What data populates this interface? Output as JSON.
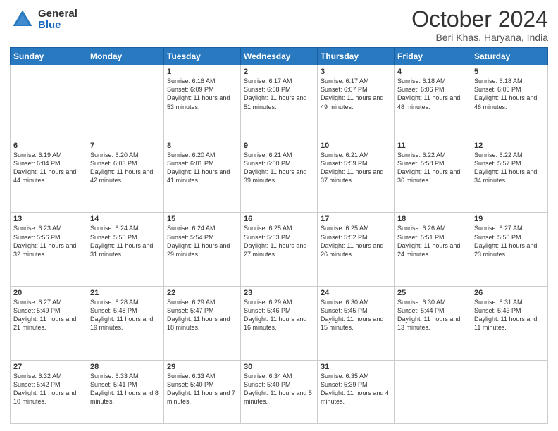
{
  "header": {
    "logo_general": "General",
    "logo_blue": "Blue",
    "month_title": "October 2024",
    "location": "Beri Khas, Haryana, India"
  },
  "weekdays": [
    "Sunday",
    "Monday",
    "Tuesday",
    "Wednesday",
    "Thursday",
    "Friday",
    "Saturday"
  ],
  "weeks": [
    [
      {
        "day": null
      },
      {
        "day": null
      },
      {
        "day": 1,
        "sunrise": "Sunrise: 6:16 AM",
        "sunset": "Sunset: 6:09 PM",
        "daylight": "Daylight: 11 hours and 53 minutes."
      },
      {
        "day": 2,
        "sunrise": "Sunrise: 6:17 AM",
        "sunset": "Sunset: 6:08 PM",
        "daylight": "Daylight: 11 hours and 51 minutes."
      },
      {
        "day": 3,
        "sunrise": "Sunrise: 6:17 AM",
        "sunset": "Sunset: 6:07 PM",
        "daylight": "Daylight: 11 hours and 49 minutes."
      },
      {
        "day": 4,
        "sunrise": "Sunrise: 6:18 AM",
        "sunset": "Sunset: 6:06 PM",
        "daylight": "Daylight: 11 hours and 48 minutes."
      },
      {
        "day": 5,
        "sunrise": "Sunrise: 6:18 AM",
        "sunset": "Sunset: 6:05 PM",
        "daylight": "Daylight: 11 hours and 46 minutes."
      }
    ],
    [
      {
        "day": 6,
        "sunrise": "Sunrise: 6:19 AM",
        "sunset": "Sunset: 6:04 PM",
        "daylight": "Daylight: 11 hours and 44 minutes."
      },
      {
        "day": 7,
        "sunrise": "Sunrise: 6:20 AM",
        "sunset": "Sunset: 6:03 PM",
        "daylight": "Daylight: 11 hours and 42 minutes."
      },
      {
        "day": 8,
        "sunrise": "Sunrise: 6:20 AM",
        "sunset": "Sunset: 6:01 PM",
        "daylight": "Daylight: 11 hours and 41 minutes."
      },
      {
        "day": 9,
        "sunrise": "Sunrise: 6:21 AM",
        "sunset": "Sunset: 6:00 PM",
        "daylight": "Daylight: 11 hours and 39 minutes."
      },
      {
        "day": 10,
        "sunrise": "Sunrise: 6:21 AM",
        "sunset": "Sunset: 5:59 PM",
        "daylight": "Daylight: 11 hours and 37 minutes."
      },
      {
        "day": 11,
        "sunrise": "Sunrise: 6:22 AM",
        "sunset": "Sunset: 5:58 PM",
        "daylight": "Daylight: 11 hours and 36 minutes."
      },
      {
        "day": 12,
        "sunrise": "Sunrise: 6:22 AM",
        "sunset": "Sunset: 5:57 PM",
        "daylight": "Daylight: 11 hours and 34 minutes."
      }
    ],
    [
      {
        "day": 13,
        "sunrise": "Sunrise: 6:23 AM",
        "sunset": "Sunset: 5:56 PM",
        "daylight": "Daylight: 11 hours and 32 minutes."
      },
      {
        "day": 14,
        "sunrise": "Sunrise: 6:24 AM",
        "sunset": "Sunset: 5:55 PM",
        "daylight": "Daylight: 11 hours and 31 minutes."
      },
      {
        "day": 15,
        "sunrise": "Sunrise: 6:24 AM",
        "sunset": "Sunset: 5:54 PM",
        "daylight": "Daylight: 11 hours and 29 minutes."
      },
      {
        "day": 16,
        "sunrise": "Sunrise: 6:25 AM",
        "sunset": "Sunset: 5:53 PM",
        "daylight": "Daylight: 11 hours and 27 minutes."
      },
      {
        "day": 17,
        "sunrise": "Sunrise: 6:25 AM",
        "sunset": "Sunset: 5:52 PM",
        "daylight": "Daylight: 11 hours and 26 minutes."
      },
      {
        "day": 18,
        "sunrise": "Sunrise: 6:26 AM",
        "sunset": "Sunset: 5:51 PM",
        "daylight": "Daylight: 11 hours and 24 minutes."
      },
      {
        "day": 19,
        "sunrise": "Sunrise: 6:27 AM",
        "sunset": "Sunset: 5:50 PM",
        "daylight": "Daylight: 11 hours and 23 minutes."
      }
    ],
    [
      {
        "day": 20,
        "sunrise": "Sunrise: 6:27 AM",
        "sunset": "Sunset: 5:49 PM",
        "daylight": "Daylight: 11 hours and 21 minutes."
      },
      {
        "day": 21,
        "sunrise": "Sunrise: 6:28 AM",
        "sunset": "Sunset: 5:48 PM",
        "daylight": "Daylight: 11 hours and 19 minutes."
      },
      {
        "day": 22,
        "sunrise": "Sunrise: 6:29 AM",
        "sunset": "Sunset: 5:47 PM",
        "daylight": "Daylight: 11 hours and 18 minutes."
      },
      {
        "day": 23,
        "sunrise": "Sunrise: 6:29 AM",
        "sunset": "Sunset: 5:46 PM",
        "daylight": "Daylight: 11 hours and 16 minutes."
      },
      {
        "day": 24,
        "sunrise": "Sunrise: 6:30 AM",
        "sunset": "Sunset: 5:45 PM",
        "daylight": "Daylight: 11 hours and 15 minutes."
      },
      {
        "day": 25,
        "sunrise": "Sunrise: 6:30 AM",
        "sunset": "Sunset: 5:44 PM",
        "daylight": "Daylight: 11 hours and 13 minutes."
      },
      {
        "day": 26,
        "sunrise": "Sunrise: 6:31 AM",
        "sunset": "Sunset: 5:43 PM",
        "daylight": "Daylight: 11 hours and 11 minutes."
      }
    ],
    [
      {
        "day": 27,
        "sunrise": "Sunrise: 6:32 AM",
        "sunset": "Sunset: 5:42 PM",
        "daylight": "Daylight: 11 hours and 10 minutes."
      },
      {
        "day": 28,
        "sunrise": "Sunrise: 6:33 AM",
        "sunset": "Sunset: 5:41 PM",
        "daylight": "Daylight: 11 hours and 8 minutes."
      },
      {
        "day": 29,
        "sunrise": "Sunrise: 6:33 AM",
        "sunset": "Sunset: 5:40 PM",
        "daylight": "Daylight: 11 hours and 7 minutes."
      },
      {
        "day": 30,
        "sunrise": "Sunrise: 6:34 AM",
        "sunset": "Sunset: 5:40 PM",
        "daylight": "Daylight: 11 hours and 5 minutes."
      },
      {
        "day": 31,
        "sunrise": "Sunrise: 6:35 AM",
        "sunset": "Sunset: 5:39 PM",
        "daylight": "Daylight: 11 hours and 4 minutes."
      },
      {
        "day": null
      },
      {
        "day": null
      }
    ]
  ]
}
